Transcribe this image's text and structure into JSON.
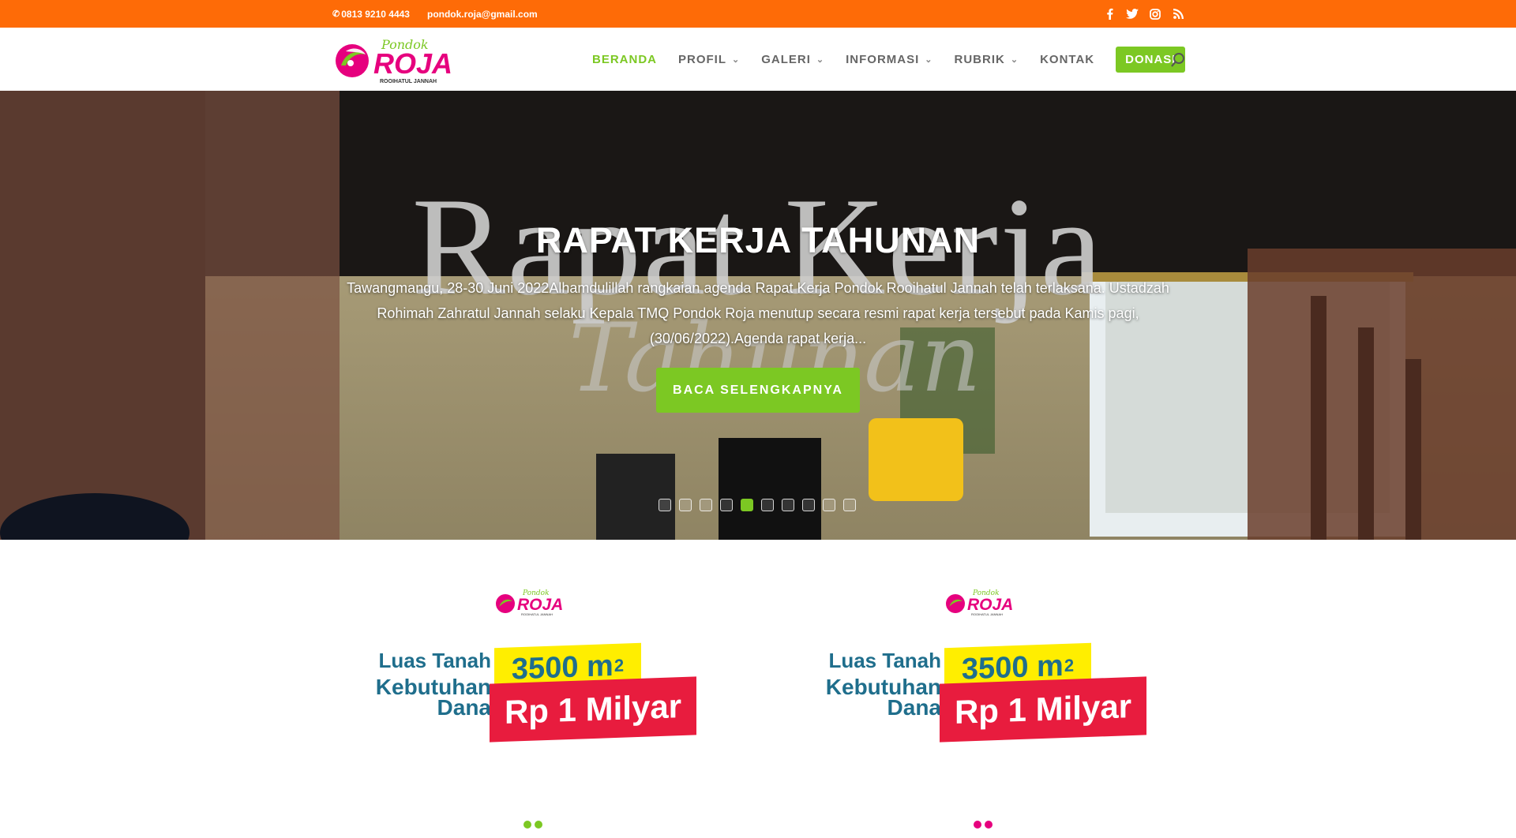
{
  "topbar": {
    "phone": "0813 9210 4443",
    "email": "pondok.roja@gmail.com",
    "social": [
      "facebook-icon",
      "twitter-icon",
      "instagram-icon",
      "rss-icon"
    ]
  },
  "logo": {
    "top": "Pondok",
    "main": "ROJA",
    "sub": "ROOIHATUL JANNAH"
  },
  "nav": {
    "beranda": "BERANDA",
    "profil": "PROFIL",
    "galeri": "GALERI",
    "informasi": "INFORMASI",
    "rubrik": "RUBRIK",
    "kontak": "KONTAK",
    "donasi": "DONASI"
  },
  "hero": {
    "image_text_1": "Rapat Kerja",
    "image_text_2": "Tahunan",
    "title": "RAPAT KERJA TAHUNAN",
    "excerpt": "Tawangmangu, 28-30 Juni 2022Alhamdulillah rangkaian agenda Rapat Kerja Pondok Rooihatul Jannah telah terlaksana. Ustadzah Rohimah Zahratul Jannah selaku Kepala TMQ Pondok Roja menutup secara resmi rapat kerja tersebut pada Kamis pagi, (30/06/2022).Agenda rapat kerja...",
    "button": "BACA SELENGKAPNYA",
    "slide_count": 10,
    "active_slide": 5
  },
  "cards": [
    {
      "label_1": "Luas Tanah",
      "area": "3500 m",
      "area_sup": "2",
      "label_2": "Kebutuhan Dana",
      "amount": "Rp 1 Milyar"
    },
    {
      "label_1": "Luas Tanah",
      "area": "3500 m",
      "area_sup": "2",
      "label_2": "Kebutuhan Dana",
      "amount": "Rp 1 Milyar"
    }
  ],
  "colors": {
    "orange": "#fe6b07",
    "green": "#7cc823",
    "pink": "#e6007e",
    "red": "#e81c3e",
    "yellow": "#ffee00",
    "blue": "#1f6e8c"
  }
}
